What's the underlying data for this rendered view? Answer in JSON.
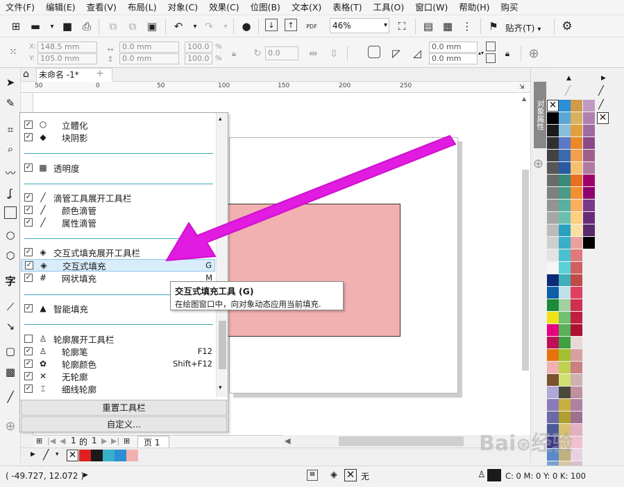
{
  "menu": [
    "文件(F)",
    "编辑(E)",
    "查看(V)",
    "布局(L)",
    "对象(C)",
    "效果(C)",
    "位图(B)",
    "文本(X)",
    "表格(T)",
    "工具(O)",
    "窗口(W)",
    "帮助(H)",
    "购买"
  ],
  "toolbar": {
    "zoom": "46%",
    "snap_label": "贴齐(T)",
    "pdf_label": "PDF"
  },
  "property_bar": {
    "x_label": "X:",
    "y_label": "Y:",
    "x_value": "148.5 mm",
    "y_value": "105.0 mm",
    "w_value": "0.0 mm",
    "h_value": "0.0 mm",
    "sx_value": "100.0",
    "sy_value": "100.0",
    "pct": "%",
    "rotation": "0.0",
    "corner1": "0.0 mm",
    "corner2": "0.0 mm"
  },
  "tab": {
    "title": "未命名 -1*",
    "add": "+"
  },
  "ruler": {
    "h": [
      "50",
      "0",
      "50",
      "100",
      "150",
      "200",
      "250"
    ]
  },
  "dropdown": {
    "rows": [
      {
        "label": "立體化",
        "sub": true,
        "icon": "⬡",
        "shortcut": ""
      },
      {
        "label": "块阴影",
        "sub": true,
        "icon": "◆",
        "shortcut": ""
      },
      {
        "label": "透明度",
        "sub": false,
        "icon": "▩",
        "shortcut": ""
      },
      {
        "label": "滴管工具展开工具栏",
        "sub": false,
        "icon": "╱",
        "shortcut": ""
      },
      {
        "label": "颜色滴管",
        "sub": true,
        "icon": "╱",
        "shortcut": ""
      },
      {
        "label": "属性滴管",
        "sub": true,
        "icon": "╱",
        "shortcut": ""
      },
      {
        "label": "交互式填充展开工具栏",
        "sub": false,
        "icon": "◈",
        "shortcut": ""
      },
      {
        "label": "交互式填充",
        "sub": true,
        "icon": "◈",
        "shortcut": "G"
      },
      {
        "label": "网状填充",
        "sub": true,
        "icon": "#",
        "shortcut": "M"
      },
      {
        "label": "智能填充",
        "sub": false,
        "icon": "▲",
        "shortcut": ""
      },
      {
        "label": "轮廓展开工具栏",
        "sub": false,
        "icon": "♙",
        "shortcut": ""
      },
      {
        "label": "轮廓笔",
        "sub": true,
        "icon": "♙",
        "shortcut": "F12"
      },
      {
        "label": "轮廓颜色",
        "sub": true,
        "icon": "✿",
        "shortcut": "Shift+F12"
      },
      {
        "label": "无轮廓",
        "sub": true,
        "icon": "✕",
        "shortcut": ""
      },
      {
        "label": "细线轮廓",
        "sub": true,
        "icon": "⌶",
        "shortcut": ""
      }
    ],
    "reset_button": "重置工具栏",
    "customize_button": "自定义..."
  },
  "tooltip": {
    "title": "交互式填充工具 (G)",
    "description": "在绘图窗口中，向对象动态应用当前填充."
  },
  "docker": {
    "tab_label": "对象属性"
  },
  "page_nav": {
    "current": "1",
    "of": "的",
    "total": "1",
    "page_tab": "页 1"
  },
  "status": {
    "coords": "( -49.727, 12.072 )",
    "fill_label": "无",
    "color_info": "C: 0 M: 0 Y: 0 K: 100"
  },
  "colors": {
    "accent_arrow": "#e21be0",
    "rect_fill": "#f2b1b1",
    "divider": "#3fa6b8"
  },
  "palette": [
    [
      "#ffffff",
      "#000000",
      "#1b1b1b",
      "#2f2f2f",
      "#434343",
      "#575757",
      "#6b6b6b",
      "#7f7f7f",
      "#939393",
      "#a7a7a7",
      "#bbbbbb",
      "#cfcfcf",
      "#e3e3e3",
      "#f5f5f5",
      "#0c2a7a",
      "#0d5fa8",
      "#1a8a3c",
      "#f0e21a",
      "#e6007e",
      "#c0105a",
      "#e8720c",
      "#f2b1b1",
      "#7a5230",
      "#b0a8d8",
      "#8a7ab8",
      "#6a6aa8",
      "#4a5a98",
      "#3a3a88",
      "#5a8ac8",
      "#7aa0d0"
    ],
    [
      "#2a8fd6",
      "#5aa8d8",
      "#88bedc",
      "#5a7ac8",
      "#3a6ab0",
      "#2a5aa0",
      "#3a8a7a",
      "#4a9a8a",
      "#5ab0a0",
      "#6ac0b0",
      "#2aa0c0",
      "#3ab0c8",
      "#4ac0d0",
      "#5ad0d8",
      "#40b0b8",
      "#c0e0e8",
      "#a0d0a0",
      "#70c070",
      "#58b058",
      "#40a040",
      "#a0c030",
      "#c0d050",
      "#d0e070",
      "#4a4a3a",
      "#c8b040",
      "#b0a030",
      "#d8c070",
      "#e8d0a0",
      "#c0b080",
      "#d8c8a0"
    ],
    [
      "#d09a4a",
      "#d8b060",
      "#e0a040",
      "#e88a2a",
      "#f0a050",
      "#f4c070",
      "#e87020",
      "#f09030",
      "#f8b060",
      "#fcd080",
      "#f8e0a0",
      "#e8a0a0",
      "#e07a7a",
      "#d06060",
      "#c04a4a",
      "#e04060",
      "#d03050",
      "#c02040",
      "#b01030",
      "#e8d8d8",
      "#d8a0a0",
      "#c88080",
      "#d0b0b0",
      "#c090a0",
      "#b080a0",
      "#a07090",
      "#e0b0c0",
      "#f0c0d0",
      "#e8d0e0",
      "#d8c0d0"
    ],
    [
      "#c09ac0",
      "#b080b0",
      "#a06aa0",
      "#8a4a8a",
      "#a0608a",
      "#b07aa0",
      "#a0006a",
      "#900070",
      "#7a3a8a",
      "#6a2a7a",
      "#5a2a6a",
      "#000000"
    ]
  ]
}
